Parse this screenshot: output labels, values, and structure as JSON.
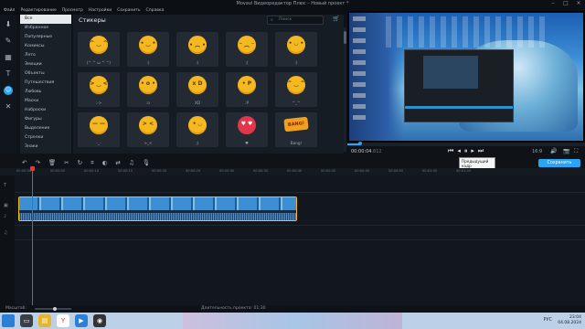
{
  "window": {
    "title": "Movavi Видеоредактор Плюс – Новый проект *"
  },
  "menu": [
    "Файл",
    "Редактирование",
    "Просмотр",
    "Настройки",
    "Сохранить",
    "Справка"
  ],
  "left_tools": [
    "import-icon",
    "filters-icon",
    "transitions-icon",
    "titles-icon",
    "stickers-icon",
    "tools-icon"
  ],
  "categories": {
    "selected": "Все",
    "items": [
      "Все",
      "Избранное",
      "Популярные",
      "Комиксы",
      "Лето",
      "Эмоции",
      "Объекты",
      "Путешествия",
      "Любовь",
      "Маски",
      "Наброски",
      "Фигуры",
      "Выделение",
      "Стрелки",
      "Знаки"
    ]
  },
  "stickers": {
    "title": "Стикеры",
    "search_placeholder": "Поиск",
    "items": [
      {
        "face": "^ ‿ ^",
        "label": "(^ ^ ω ^ ^)"
      },
      {
        "face": "• ‿ •",
        "label": ":)"
      },
      {
        "face": "• ︵ •",
        "label": ":("
      },
      {
        "face": "ᵔ ︵ ᵔ",
        "label": ";("
      },
      {
        "face": "• ◡ •",
        "label": ":)"
      },
      {
        "face": "> ‿ <",
        "label": ":->"
      },
      {
        "face": "• o •",
        "label": ":o"
      },
      {
        "face": "x D",
        "label": "XD"
      },
      {
        "face": "• P",
        "label": ":P"
      },
      {
        "face": "^ ‿ ^",
        "label": "^_^"
      },
      {
        "face": "— —",
        "label": "-_-"
      },
      {
        "face": "> <",
        "label": ">_<"
      },
      {
        "face": "• ◡",
        "label": ";)"
      },
      {
        "face": "♥ ♥",
        "label": "♥"
      },
      {
        "face": "BANG!",
        "label": "Bang!"
      }
    ]
  },
  "player": {
    "time_current": "00:00:04",
    "time_frac": ".812",
    "ratio": "16:9",
    "controls": [
      "prev-icon",
      "step-back-icon",
      "pause-icon",
      "step-forward-icon",
      "next-icon"
    ],
    "tooltip_line1": "Предыдущий кадр",
    "tooltip_line2": "(Ctrl + ←)"
  },
  "save_button": "Сохранить",
  "timeline": {
    "ticks": [
      "00:00:00",
      "00:00:05",
      "00:00:10",
      "00:00:15",
      "00:00:20",
      "00:00:25",
      "00:00:30",
      "00:00:35",
      "00:00:40",
      "00:00:45",
      "00:00:50",
      "00:00:55",
      "00:01:00",
      "00:01:05"
    ],
    "toolbar_icons": [
      "undo-icon",
      "redo-icon",
      "delete-icon",
      "cut-icon",
      "rotate-icon",
      "crop-icon",
      "color-icon",
      "transition-icon",
      "audio-icon",
      "record-icon"
    ]
  },
  "status": {
    "scale_label": "Масштаб:",
    "duration": "Длительность проекта: 01:30"
  },
  "taskbar": {
    "clock_time": "23:04",
    "clock_date": "04.08.2024",
    "lang": "РУС"
  }
}
